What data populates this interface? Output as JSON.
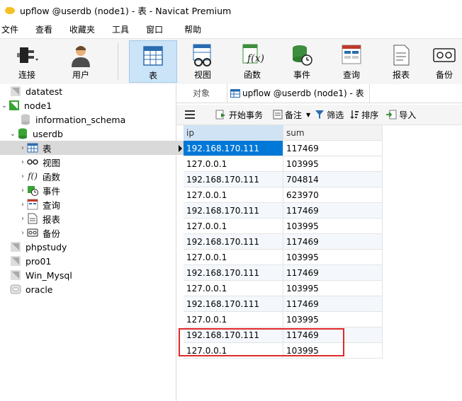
{
  "window": {
    "title": "upflow @userdb (node1) - 表 - Navicat Premium"
  },
  "menu": {
    "items": [
      "文件",
      "查看",
      "收藏夹",
      "工具",
      "窗口",
      "帮助"
    ]
  },
  "toolbar": {
    "connect": "连接",
    "user": "用户",
    "table": "表",
    "view": "视图",
    "function": "函数",
    "event": "事件",
    "query": "查询",
    "report": "报表",
    "backup": "备份"
  },
  "tree": {
    "datatest": "datatest",
    "node1": "node1",
    "information_schema": "information_schema",
    "userdb": "userdb",
    "table": "表",
    "view": "视图",
    "function": "函数",
    "event": "事件",
    "query": "查询",
    "report": "报表",
    "backup": "备份",
    "phpstudy": "phpstudy",
    "pro01": "pro01",
    "win_mysql": "Win_Mysql",
    "oracle": "oracle"
  },
  "tabs": {
    "objects": "对象",
    "table_tab": "upflow @userdb (node1) - 表"
  },
  "subtoolbar": {
    "begin_tx": "开始事务",
    "note": "备注",
    "filter": "筛选",
    "sort": "排序",
    "import": "导入"
  },
  "grid": {
    "columns": [
      "ip",
      "sum"
    ],
    "rows": [
      [
        "192.168.170.111",
        "117469"
      ],
      [
        "127.0.0.1",
        "103995"
      ],
      [
        "192.168.170.111",
        "704814"
      ],
      [
        "127.0.0.1",
        "623970"
      ],
      [
        "192.168.170.111",
        "117469"
      ],
      [
        "127.0.0.1",
        "103995"
      ],
      [
        "192.168.170.111",
        "117469"
      ],
      [
        "127.0.0.1",
        "103995"
      ],
      [
        "192.168.170.111",
        "117469"
      ],
      [
        "127.0.0.1",
        "103995"
      ],
      [
        "192.168.170.111",
        "117469"
      ],
      [
        "127.0.0.1",
        "103995"
      ],
      [
        "192.168.170.111",
        "117469"
      ],
      [
        "127.0.0.1",
        "103995"
      ]
    ]
  }
}
